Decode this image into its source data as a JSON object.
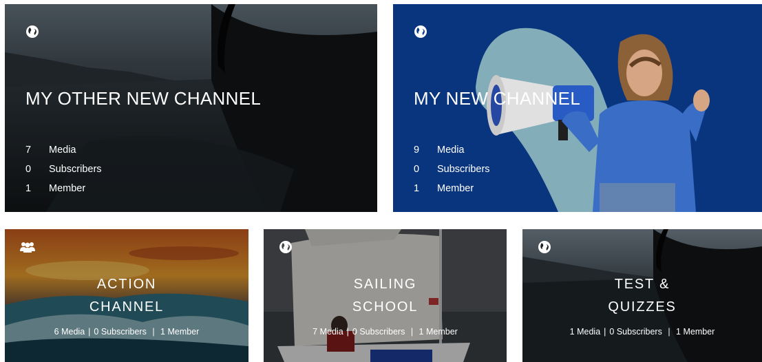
{
  "channels_large": [
    {
      "title": "MY OTHER NEW CHANNEL",
      "visibility_icon": "globe-icon",
      "stats": [
        {
          "value": "7",
          "label": "Media"
        },
        {
          "value": "0",
          "label": "Subscribers"
        },
        {
          "value": "1",
          "label": "Member"
        }
      ]
    },
    {
      "title": "MY NEW CHANNEL",
      "visibility_icon": "globe-icon",
      "stats": [
        {
          "value": "9",
          "label": "Media"
        },
        {
          "value": "0",
          "label": "Subscribers"
        },
        {
          "value": "1",
          "label": "Member"
        }
      ]
    }
  ],
  "channels_small": [
    {
      "title_line1": "ACTION",
      "title_line2": "CHANNEL",
      "visibility_icon": "group-icon",
      "media": "6 Media",
      "subscribers": "0 Subscribers",
      "members": "1 Member"
    },
    {
      "title_line1": "SAILING",
      "title_line2": "SCHOOL",
      "visibility_icon": "globe-icon",
      "media": "7 Media",
      "subscribers": "0 Subscribers",
      "members": "1 Member"
    },
    {
      "title_line1": "TEST &",
      "title_line2": "QUIZZES",
      "visibility_icon": "globe-icon",
      "media": "1 Media",
      "subscribers": "0 Subscribers",
      "members": "1 Member"
    }
  ],
  "colors": {
    "new_channel_blue": "#0a3a8a",
    "card_dark": "#1b1f22",
    "text": "#ffffff"
  }
}
